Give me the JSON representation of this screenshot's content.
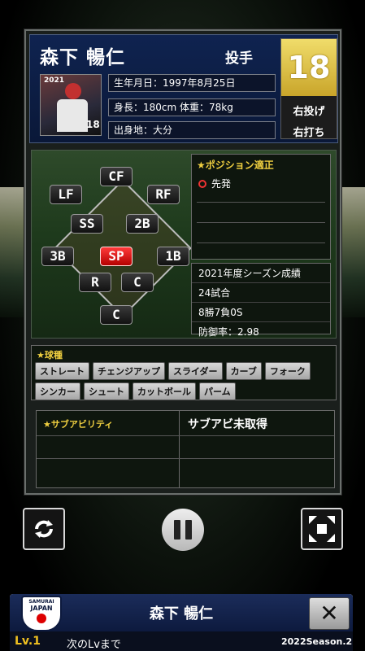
{
  "player": {
    "name": "森下 暢仁",
    "position": "投手",
    "number": "18",
    "throws": "右投げ",
    "bats": "右打ち",
    "portrait_year": "2021",
    "portrait_number": "18",
    "birthday": "生年月日：1997年8月25日",
    "body": "身長：180cm 体重：78kg",
    "birthplace": "出身地：大分"
  },
  "field": {
    "positions": [
      "CF",
      "LF",
      "RF",
      "SS",
      "2B",
      "3B",
      "SP",
      "1B",
      "R",
      "C",
      "C"
    ],
    "active_position": "SP"
  },
  "aptitude": {
    "title": "★ポジション適正",
    "items": [
      "先発"
    ]
  },
  "season_stats": {
    "title": "2021年度シーズン成績",
    "games": "24試合",
    "record": "8勝7負0S",
    "era": "防御率：2.98"
  },
  "pitches": {
    "title": "★球種",
    "items": [
      "ストレート",
      "チェンジアップ",
      "スライダー",
      "カーブ",
      "フォーク",
      "シンカー",
      "シュート",
      "カットボール",
      "パーム"
    ]
  },
  "sub_ability": {
    "title": "★サブアビリティ",
    "value": "サブアビ未取得"
  },
  "bottom_bar": {
    "logo_line1": "SAMURAI",
    "logo_line2": "JAPAN",
    "name": "森下 暢仁",
    "close": "✕",
    "level": "Lv.1",
    "next_level": "次のLvまで",
    "season": "2022Season.2"
  },
  "icons": {
    "left_control": "refresh-icon",
    "center_control": "pause-icon",
    "right_control": "collapse-icon"
  },
  "colors": {
    "active_position": "#d00000",
    "gold_number": "#e0c040",
    "header_blue": "#0f2350"
  }
}
